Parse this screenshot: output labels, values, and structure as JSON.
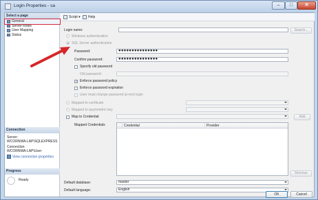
{
  "window": {
    "title": "Login Properties - sa",
    "min_glyph": "–",
    "max_glyph": "□",
    "close_glyph": "✕"
  },
  "left": {
    "select_page_header": "Select a page",
    "pages": [
      "General",
      "Server Roles",
      "User Mapping",
      "Status"
    ],
    "connection_header": "Connection",
    "server_label": "Server:",
    "server_value": "WCORNWA-LAP\\SQLEXPRESS",
    "connection_label": "Connection:",
    "connection_value": "WCORNWA-LAP\\User",
    "view_connection_link": "View connection properties",
    "progress_header": "Progress",
    "progress_status": "Ready"
  },
  "toolbar": {
    "script_label": "Script",
    "script_arrow": "▾",
    "help_label": "Help"
  },
  "form": {
    "login_name_label": "Login name:",
    "login_name_value": "",
    "search_button": "Search...",
    "windows_auth_label": "Windows authentication",
    "sql_auth_label": "SQL Server authentication",
    "password_label": "Password:",
    "password_value": "●●●●●●●●●●●●●●●",
    "confirm_password_label": "Confirm password:",
    "confirm_password_value": "●●●●●●●●●●●●●●●",
    "specify_old_password_label": "Specify old password",
    "old_password_label": "Old password:",
    "enforce_policy_label": "Enforce password policy",
    "enforce_expiration_label": "Enforce password expiration",
    "must_change_label": "User must change password at next login",
    "mapped_certificate_label": "Mapped to certificate",
    "mapped_asym_key_label": "Mapped to asymmetric key",
    "map_credential_label": "Map to Credential",
    "add_button": "Add",
    "mapped_credentials_label": "Mapped Credentials",
    "credential_columns": [
      "Credential",
      "Provider"
    ],
    "remove_button": "Remove",
    "default_database_label": "Default database:",
    "default_database_value": "master",
    "default_language_label": "Default language:",
    "default_language_value": "English",
    "check_mark": "✓"
  },
  "footer": {
    "ok_button": "OK",
    "cancel_button": "Cancel"
  },
  "colors": {
    "annotation_arrow": "#d6262a",
    "selected_outline": "#d6263a",
    "link": "#2a5db0"
  }
}
